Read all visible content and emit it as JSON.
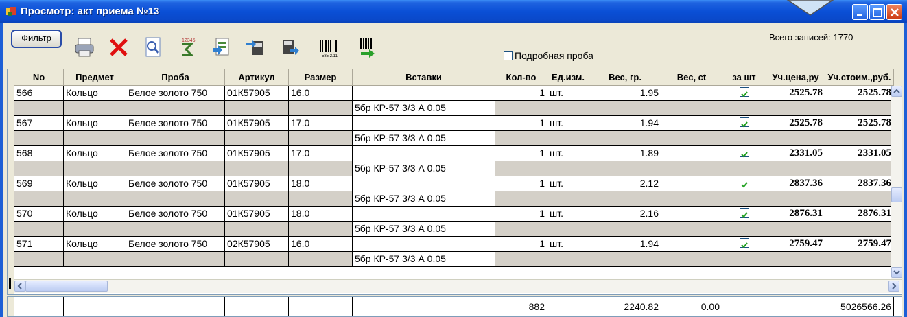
{
  "window": {
    "title": "Просмотр: акт приема №13",
    "accent": "#0a4fd6"
  },
  "toolbar": {
    "filter_label": "Фильтр",
    "tools": [
      "printer-icon",
      "delete-icon",
      "preview-icon",
      "sum-icon",
      "export-icon",
      "move-in-icon",
      "move-out-icon",
      "barcode-icon",
      "barcode-arrow-icon"
    ],
    "detailed_check_label": "Подробная проба",
    "detailed_check_value": false,
    "records_label": "Всего записей: 1770"
  },
  "grid": {
    "columns": [
      "No",
      "Предмет",
      "Проба",
      "Артикул",
      "Размер",
      "Вставки",
      "Кол-во",
      "Ед.изм.",
      "Вес, гр.",
      "Вес, ct",
      "за шт",
      "Уч.цена,ру",
      "Уч.стоим.,руб."
    ],
    "rows": [
      {
        "no": "566",
        "item": "Кольцо",
        "probe": "Белое золото 750",
        "article": "01К57905",
        "size": "16.0",
        "qty": "1",
        "unit": "шт.",
        "weight": "1.95",
        "per_piece": true,
        "price": "2525.78",
        "cost": "2525.78",
        "insert": "5бр КР-57 3/3 А 0.05"
      },
      {
        "no": "567",
        "item": "Кольцо",
        "probe": "Белое золото 750",
        "article": "01К57905",
        "size": "17.0",
        "qty": "1",
        "unit": "шт.",
        "weight": "1.94",
        "per_piece": true,
        "price": "2525.78",
        "cost": "2525.78",
        "insert": "5бр КР-57 3/3 А 0.05"
      },
      {
        "no": "568",
        "item": "Кольцо",
        "probe": "Белое золото 750",
        "article": "01К57905",
        "size": "17.0",
        "qty": "1",
        "unit": "шт.",
        "weight": "1.89",
        "per_piece": true,
        "price": "2331.05",
        "cost": "2331.05",
        "insert": "5бр КР-57 3/3 А 0.05"
      },
      {
        "no": "569",
        "item": "Кольцо",
        "probe": "Белое золото 750",
        "article": "01К57905",
        "size": "18.0",
        "qty": "1",
        "unit": "шт.",
        "weight": "2.12",
        "per_piece": true,
        "price": "2837.36",
        "cost": "2837.36",
        "insert": "5бр КР-57 3/3 А 0.05"
      },
      {
        "no": "570",
        "item": "Кольцо",
        "probe": "Белое золото 750",
        "article": "01К57905",
        "size": "18.0",
        "qty": "1",
        "unit": "шт.",
        "weight": "2.16",
        "per_piece": true,
        "price": "2876.31",
        "cost": "2876.31",
        "insert": "5бр КР-57 3/3 А 0.05"
      },
      {
        "no": "571",
        "item": "Кольцо",
        "probe": "Белое золото 750",
        "article": "02К57905",
        "size": "16.0",
        "qty": "1",
        "unit": "шт.",
        "weight": "1.94",
        "per_piece": true,
        "price": "2759.47",
        "cost": "2759.47",
        "insert": "5бр КР-57 3/3 А 0.05"
      }
    ]
  },
  "totals": {
    "qty": "882",
    "weight": "2240.82",
    "weight_ct": "0.00",
    "cost": "5026566.26"
  }
}
